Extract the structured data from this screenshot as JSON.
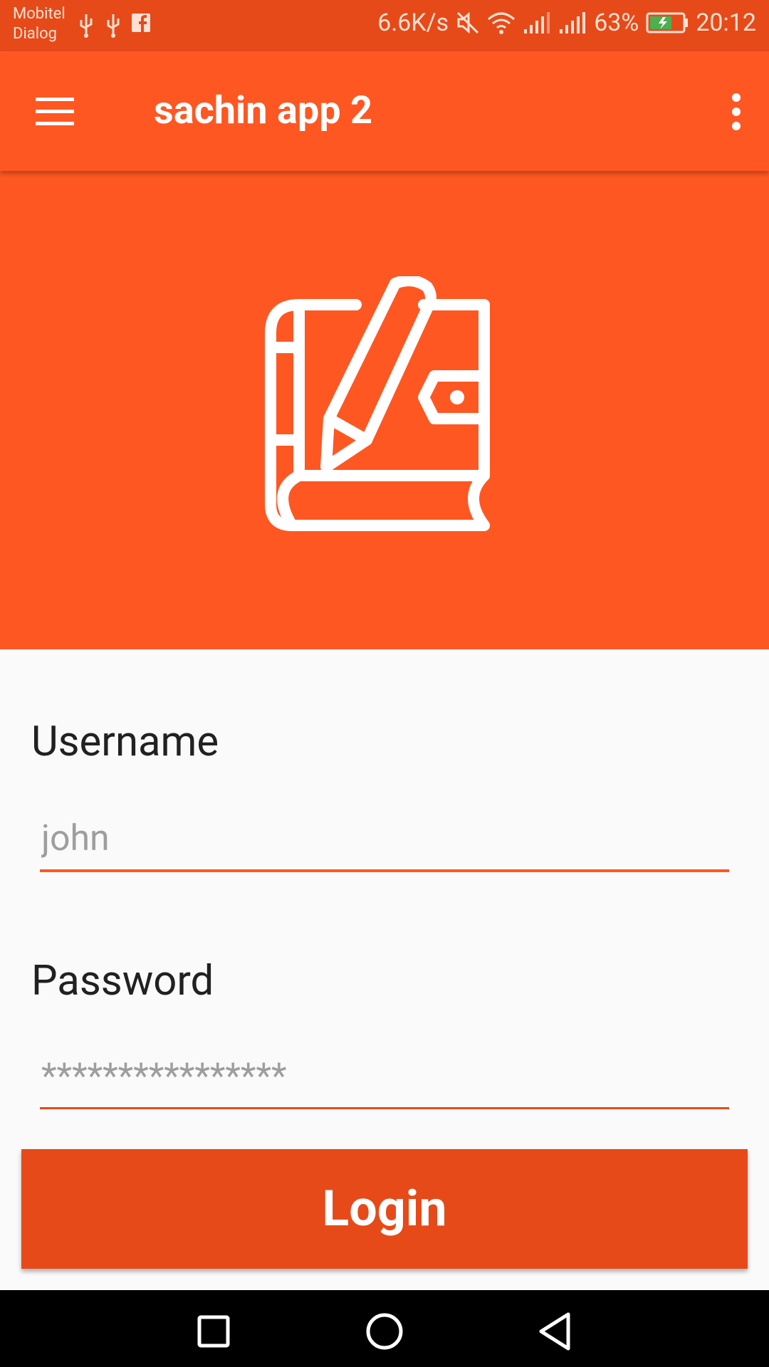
{
  "status_bar": {
    "carrier_1": "Mobitel",
    "carrier_2": "Dialog",
    "speed": "6.6K/s",
    "battery": "63%",
    "time": "20:12",
    "icons_left": [
      "usb-icon",
      "usb-icon",
      "facebook-icon"
    ],
    "icons_right": [
      "mute-icon",
      "wifi-icon",
      "signal-icon",
      "signal-icon",
      "battery-icon"
    ]
  },
  "app_bar": {
    "title": "sachin app 2",
    "menu_icon": "hamburger-menu-icon",
    "more_icon": "more-vertical-icon"
  },
  "hero": {
    "icon": "notebook-pencil-icon"
  },
  "form": {
    "username_label": "Username",
    "username_placeholder": "john",
    "password_label": "Password",
    "password_placeholder": "****************",
    "login_label": "Login"
  },
  "colors": {
    "primary": "#ff5722",
    "primary_dark": "#e64a19",
    "background": "#fafafa"
  },
  "nav_bar": {
    "buttons": [
      "recent-apps-icon",
      "home-icon",
      "back-icon"
    ]
  }
}
